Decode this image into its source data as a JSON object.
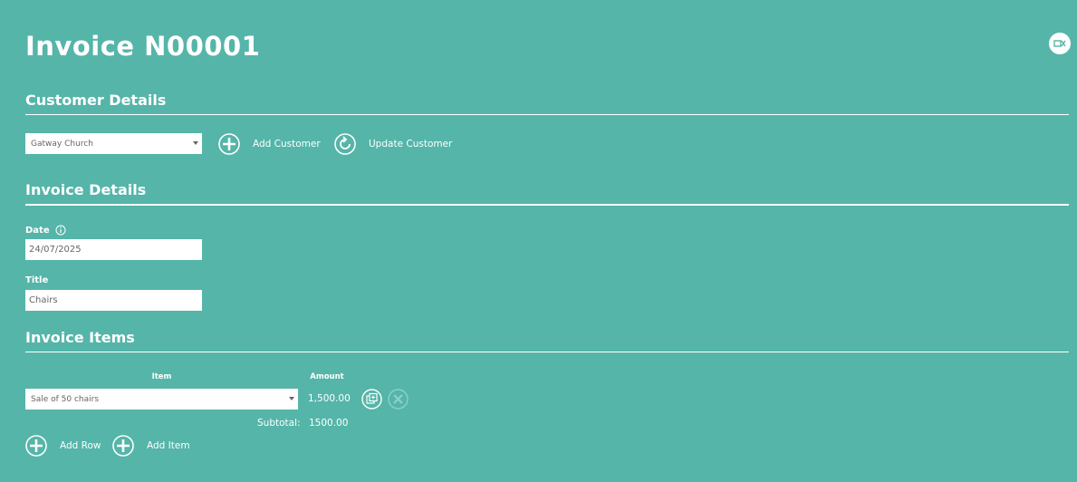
{
  "header": {
    "title": "Invoice N00001"
  },
  "customer": {
    "heading": "Customer Details",
    "selected": "Gatway Church",
    "add_label": "Add Customer",
    "update_label": "Update Customer"
  },
  "invoice": {
    "heading": "Invoice Details",
    "date_label": "Date",
    "date_value": "24/07/2025",
    "title_label": "Title",
    "title_value": "Chairs"
  },
  "items": {
    "heading": "Invoice Items",
    "col_item": "Item",
    "col_amount": "Amount",
    "rows": [
      {
        "item": "Sale of 50 chairs",
        "amount": "1,500.00"
      }
    ],
    "subtotal_label": "Subtotal:",
    "subtotal_value": "1500.00",
    "add_row_label": "Add Row",
    "add_item_label": "Add Item"
  }
}
